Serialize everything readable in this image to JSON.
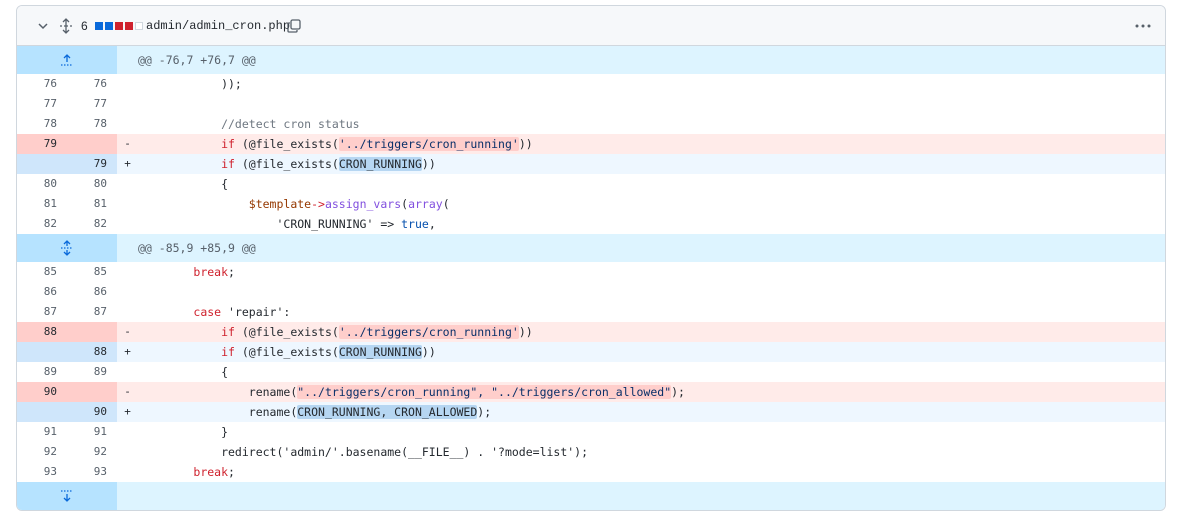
{
  "file": {
    "changes_count": "6",
    "filename": "admin/admin_cron.php",
    "diffstat_colors": [
      "#0969da",
      "#0969da",
      "#cf222e",
      "#cf222e",
      "#ffffff"
    ]
  },
  "hunks": [
    {
      "header": "@@ -76,7 +76,7 @@"
    },
    {
      "header": "@@ -85,9 +85,9 @@"
    }
  ],
  "lines": {
    "l76": {
      "old": "76",
      "new": "76"
    },
    "l77": {
      "old": "77",
      "new": "77"
    },
    "l78": {
      "old": "78",
      "new": "78"
    },
    "l79d": {
      "old": "79",
      "marker": "-"
    },
    "l79a": {
      "new": "79",
      "marker": "+"
    },
    "l80": {
      "old": "80",
      "new": "80"
    },
    "l81": {
      "old": "81",
      "new": "81"
    },
    "l82": {
      "old": "82",
      "new": "82"
    },
    "l85": {
      "old": "85",
      "new": "85"
    },
    "l86": {
      "old": "86",
      "new": "86"
    },
    "l87": {
      "old": "87",
      "new": "87"
    },
    "l88d": {
      "old": "88",
      "marker": "-"
    },
    "l88a": {
      "new": "88",
      "marker": "+"
    },
    "l89": {
      "old": "89",
      "new": "89"
    },
    "l90d": {
      "old": "90",
      "marker": "-"
    },
    "l90a": {
      "new": "90",
      "marker": "+"
    },
    "l91": {
      "old": "91",
      "new": "91"
    },
    "l92": {
      "old": "92",
      "new": "92"
    },
    "l93": {
      "old": "93",
      "new": "93"
    }
  },
  "code": {
    "c76": "            ));",
    "c78": "            //detect cron status",
    "c79d_a": "            ",
    "c79d_b": "if",
    "c79d_c": " (@file_exists(",
    "c79d_d": "'../triggers/cron_running'",
    "c79d_e": "))",
    "c79a_a": "            ",
    "c79a_b": "if",
    "c79a_c": " (@file_exists(",
    "c79a_d": "CRON_RUNNING",
    "c79a_e": "))",
    "c80": "            {",
    "c81_a": "                ",
    "c81_b": "$template",
    "c81_c": "->",
    "c81_d": "assign_vars",
    "c81_e": "(",
    "c81_f": "array",
    "c81_g": "(",
    "c82_a": "                    'CRON_RUNNING' => ",
    "c82_b": "true",
    "c82_c": ",",
    "c85_a": "        ",
    "c85_b": "break",
    "c85_c": ";",
    "c87_a": "        ",
    "c87_b": "case",
    "c87_c": " 'repair':",
    "c88d_a": "            ",
    "c88d_b": "if",
    "c88d_c": " (@file_exists(",
    "c88d_d": "'../triggers/cron_running'",
    "c88d_e": "))",
    "c88a_a": "            ",
    "c88a_b": "if",
    "c88a_c": " (@file_exists(",
    "c88a_d": "CRON_RUNNING",
    "c88a_e": "))",
    "c89": "            {",
    "c90d_a": "                rename(",
    "c90d_b": "\"../triggers/cron_running\", \"../triggers/cron_allowed\"",
    "c90d_c": ");",
    "c90a_a": "                rename(",
    "c90a_b": "CRON_RUNNING, CRON_ALLOWED",
    "c90a_c": ");",
    "c91": "            }",
    "c92": "            redirect('admin/'.basename(__FILE__) . '?mode=list');",
    "c93_a": "        ",
    "c93_b": "break",
    "c93_c": ";"
  }
}
